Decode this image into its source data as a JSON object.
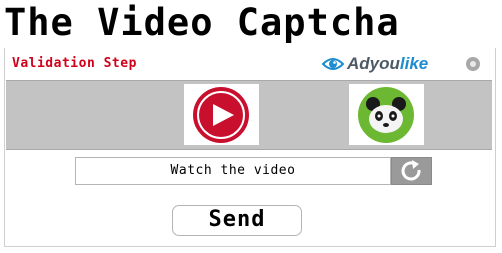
{
  "page": {
    "title": "The Video Captcha"
  },
  "widget": {
    "step_label": "Validation Step",
    "brand": {
      "name_part1": "Adyou",
      "name_part2": "like",
      "icons": [
        "eye-icon",
        "info-icon"
      ]
    },
    "choices": [
      {
        "icon": "play-icon",
        "color": "#c8102e"
      },
      {
        "icon": "panda-icon",
        "color": "#6cb833"
      }
    ],
    "input": {
      "value": "Watch the video",
      "reload_icon": "reload-icon"
    },
    "send_label": "Send"
  },
  "colors": {
    "step_label": "#d0021b",
    "band": "#c3c3c3",
    "reload_button": "#9a9a9a"
  }
}
